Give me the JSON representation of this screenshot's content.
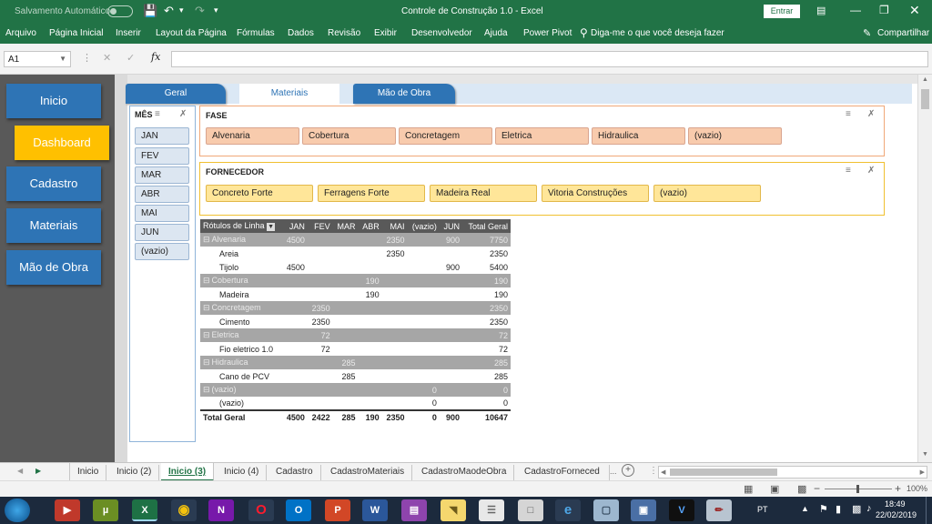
{
  "titlebar": {
    "autosave_label": "Salvamento Automático",
    "autosave_state": "off",
    "title": "Controle de Construção 1.0 - Excel",
    "signin_label": "Entrar"
  },
  "ribbon": {
    "tabs": [
      "Arquivo",
      "Página Inicial",
      "Inserir",
      "Layout da Página",
      "Fórmulas",
      "Dados",
      "Revisão",
      "Exibir",
      "Desenvolvedor",
      "Ajuda",
      "Power Pivot"
    ],
    "tell_me": "Diga-me o que você deseja fazer",
    "share_label": "Compartilhar"
  },
  "formula_bar": {
    "name_box": "A1",
    "fx": "fx",
    "formula_value": ""
  },
  "sidebar": {
    "items": [
      {
        "label": "Inicio",
        "state": "normal"
      },
      {
        "label": "Dashboard",
        "state": "active"
      },
      {
        "label": "Cadastro",
        "state": "normal"
      },
      {
        "label": "Materiais",
        "state": "normal"
      },
      {
        "label": "Mão de Obra",
        "state": "normal"
      }
    ]
  },
  "content_tabs": [
    {
      "label": "Geral",
      "active": false
    },
    {
      "label": "Materiais",
      "active": true
    },
    {
      "label": "Mão de Obra",
      "active": false
    }
  ],
  "slicers": {
    "month": {
      "title": "MÊS",
      "items": [
        "JAN",
        "FEV",
        "MAR",
        "ABR",
        "MAI",
        "JUN",
        "(vazio)"
      ]
    },
    "phase": {
      "title": "FASE",
      "items": [
        "Alvenaria",
        "Cobertura",
        "Concretagem",
        "Eletrica",
        "Hidraulica",
        "(vazio)"
      ]
    },
    "supplier": {
      "title": "FORNECEDOR",
      "items": [
        "Concreto Forte",
        "Ferragens Forte",
        "Madeira Real",
        "Vitoria Construções",
        "(vazio)"
      ]
    }
  },
  "pivot": {
    "headers": [
      "Rótulos de Linha",
      "JAN",
      "FEV",
      "MAR",
      "ABR",
      "MAI",
      "(vazio)",
      "JUN",
      "Total Geral"
    ],
    "rows": [
      {
        "type": "group",
        "label": "Alvenaria",
        "values": [
          "4500",
          "",
          "",
          "",
          "2350",
          "",
          "900",
          "7750"
        ]
      },
      {
        "type": "item",
        "label": "Areia",
        "values": [
          "",
          "",
          "",
          "",
          "2350",
          "",
          "",
          "2350"
        ]
      },
      {
        "type": "item",
        "label": "Tijolo",
        "values": [
          "4500",
          "",
          "",
          "",
          "",
          "",
          "900",
          "5400"
        ]
      },
      {
        "type": "group",
        "label": "Cobertura",
        "values": [
          "",
          "",
          "",
          "190",
          "",
          "",
          "",
          "190"
        ]
      },
      {
        "type": "item",
        "label": "Madeira",
        "values": [
          "",
          "",
          "",
          "190",
          "",
          "",
          "",
          "190"
        ]
      },
      {
        "type": "group",
        "label": "Concretagem",
        "values": [
          "",
          "2350",
          "",
          "",
          "",
          "",
          "",
          "2350"
        ]
      },
      {
        "type": "item",
        "label": "Cimento",
        "values": [
          "",
          "2350",
          "",
          "",
          "",
          "",
          "",
          "2350"
        ]
      },
      {
        "type": "group",
        "label": "Eletrica",
        "values": [
          "",
          "72",
          "",
          "",
          "",
          "",
          "",
          "72"
        ]
      },
      {
        "type": "item",
        "label": "Fio eletrico 1.0",
        "values": [
          "",
          "72",
          "",
          "",
          "",
          "",
          "",
          "72"
        ]
      },
      {
        "type": "group",
        "label": "Hidraulica",
        "values": [
          "",
          "",
          "285",
          "",
          "",
          "",
          "",
          "285"
        ]
      },
      {
        "type": "item",
        "label": "Cano de PCV",
        "values": [
          "",
          "",
          "285",
          "",
          "",
          "",
          "",
          "285"
        ]
      },
      {
        "type": "group",
        "label": "(vazio)",
        "values": [
          "",
          "",
          "",
          "",
          "",
          "0",
          "",
          "0"
        ]
      },
      {
        "type": "item",
        "label": "(vazio)",
        "values": [
          "",
          "",
          "",
          "",
          "",
          "0",
          "",
          "0"
        ]
      },
      {
        "type": "total",
        "label": "Total Geral",
        "values": [
          "4500",
          "2422",
          "285",
          "190",
          "2350",
          "0",
          "900",
          "10647"
        ]
      }
    ]
  },
  "sheet_tabs": {
    "items": [
      "Inicio",
      "Inicio (2)",
      "Inicio (3)",
      "Inicio (4)",
      "Cadastro",
      "CadastroMateriais",
      "CadastroMaodeObra",
      "CadastroForneced"
    ],
    "active": "Inicio (3)",
    "more": "..."
  },
  "statusbar": {
    "zoom": "100%"
  },
  "taskbar": {
    "lang": "PT",
    "time": "18:49",
    "date": "22/02/2019"
  },
  "colors": {
    "excel_green": "#217346",
    "nav_blue": "#2e74b5",
    "nav_active": "#ffc000",
    "phase_chip": "#f8cbad",
    "supplier_chip": "#ffe699",
    "month_chip": "#dce6f1",
    "pivot_header": "#595959",
    "pivot_group": "#a6a6a6"
  }
}
